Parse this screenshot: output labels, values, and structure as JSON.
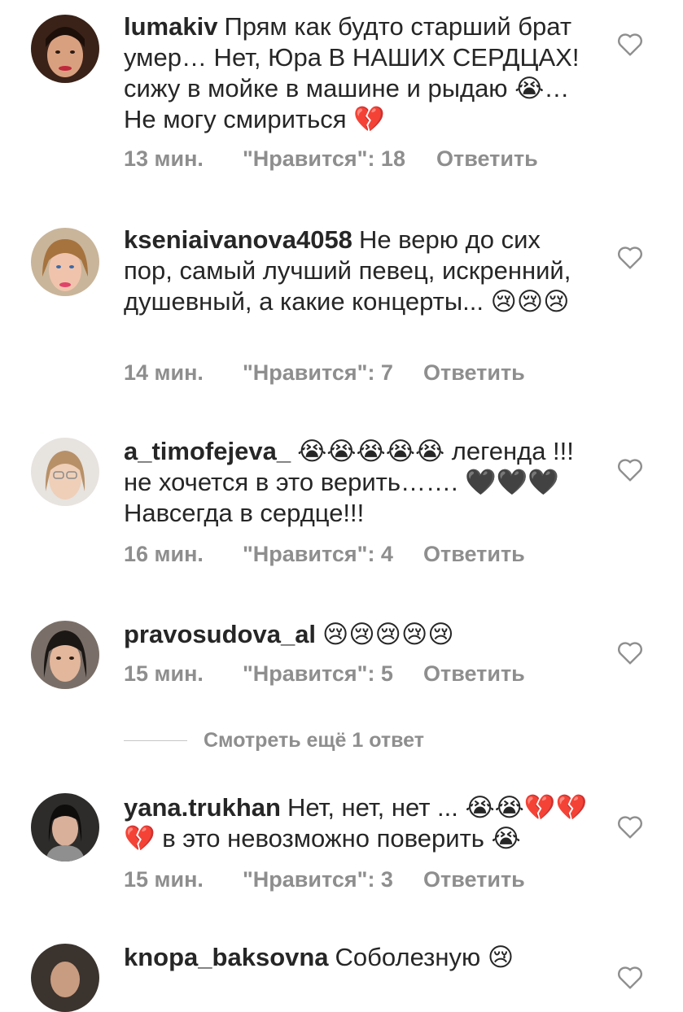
{
  "comments": [
    {
      "username": "lumakiv",
      "text": "Прям как будто старший брат умер… Нет, Юра В НАШИХ СЕРДЦАХ! сижу в мойке в машине и рыдаю 😭… Не могу смириться 💔",
      "time": "13 мин.",
      "likes": "\"Нравится\": 18",
      "reply": "Ответить"
    },
    {
      "username": "kseniaivanova4058",
      "text": "Не верю до сих пор, самый лучший певец, искренний, душевный, а какие концерты... 😢😢😢",
      "time": "14 мин.",
      "likes": "\"Нравится\": 7",
      "reply": "Ответить"
    },
    {
      "username": "a_timofejeva_",
      "text": "😭😭😭😭😭 легенда !!! не хочется в это верить……. 🖤🖤🖤 Навсегда в сердце!!!",
      "time": "16 мин.",
      "likes": "\"Нравится\": 4",
      "reply": "Ответить"
    },
    {
      "username": "pravosudova_al",
      "text": "😢😢😢😢😢",
      "time": "15 мин.",
      "likes": "\"Нравится\": 5",
      "reply": "Ответить"
    },
    {
      "username": "yana.trukhan",
      "text": "Нет, нет, нет ... 😭😭💔💔💔 в это невозможно поверить 😭",
      "time": "15 мин.",
      "likes": "\"Нравится\": 3",
      "reply": "Ответить"
    },
    {
      "username": "knopa_baksovna",
      "text": "Соболезную 😢"
    }
  ],
  "view_replies": "Смотреть ещё 1 ответ",
  "colors": {
    "text": "#262626",
    "muted": "#8e8e8e",
    "heart_outline": "#8e8e8e"
  }
}
